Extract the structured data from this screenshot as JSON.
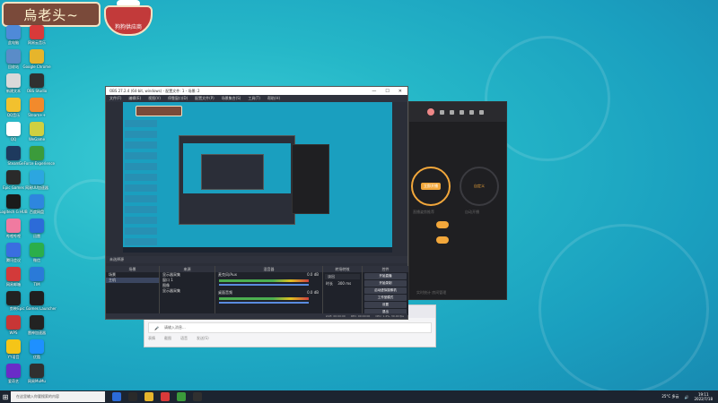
{
  "logo": {
    "title": "烏老头~",
    "bowl_label": "狗狗供应商"
  },
  "desktop_icons": [
    {
      "label": "此电脑",
      "color": "#4f8ad8"
    },
    {
      "label": "网易云音乐",
      "color": "#d83a3a"
    },
    {
      "label": "回收站",
      "color": "#5a8cc8"
    },
    {
      "label": "Google Chrome",
      "color": "#e6b52c"
    },
    {
      "label": "新建文本",
      "color": "#d9d9d9"
    },
    {
      "label": "OBS Studio",
      "color": "#303030"
    },
    {
      "label": "QQ音乐",
      "color": "#f2c12e"
    },
    {
      "label": "Steam++",
      "color": "#f28a2c"
    },
    {
      "label": "QQ",
      "color": "#ffffff"
    },
    {
      "label": "WeGame",
      "color": "#d0d040"
    },
    {
      "label": "Steam",
      "color": "#1e3a5e"
    },
    {
      "label": "GeForce Experience",
      "color": "#3b9b3b"
    },
    {
      "label": "Epic Games",
      "color": "#2a2a2a"
    },
    {
      "label": "网易UU加速器",
      "color": "#2ca6e0"
    },
    {
      "label": "Logitech G HUB",
      "color": "#1a1a1a"
    },
    {
      "label": "百度网盘",
      "color": "#2e86de"
    },
    {
      "label": "哔哩哔哩",
      "color": "#f07aa0"
    },
    {
      "label": "迅雷",
      "color": "#2c6bd8"
    },
    {
      "label": "腾讯会议",
      "color": "#3a6ee0"
    },
    {
      "label": "微信",
      "color": "#2bae4a"
    },
    {
      "label": "网易邮箱",
      "color": "#d33a3a"
    },
    {
      "label": "TIM",
      "color": "#2a7ad8"
    },
    {
      "label": "剪映",
      "color": "#222222"
    },
    {
      "label": "Epic Games Launcher",
      "color": "#1f1f1f"
    },
    {
      "label": "WPS",
      "color": "#c83636"
    },
    {
      "label": "雷神加速器",
      "color": "#222222"
    },
    {
      "label": "YY语音",
      "color": "#f5c518"
    },
    {
      "label": "优酷",
      "color": "#1e90ff"
    },
    {
      "label": "爱奇艺",
      "color": "#6a2cc8"
    },
    {
      "label": "网易MuMu",
      "color": "#303030"
    }
  ],
  "obs": {
    "title": "OBS 27.2.4 (64-bit, windows) - 配置文件: 1 - 场景: 2",
    "menu": [
      "文件(F)",
      "编辑(E)",
      "视图(V)",
      "停靠窗口(D)",
      "配置文件(P)",
      "场景集合(S)",
      "工具(T)",
      "帮助(H)"
    ],
    "window_controls": [
      "—",
      "☐",
      "✕"
    ],
    "source_bar": "未选择源",
    "scenes_header": "场景",
    "scenes": [
      "场景",
      "主机"
    ],
    "sources_header": "来源",
    "sources": [
      "显示器采集",
      "窗口 1",
      "图像",
      "显示器采集"
    ],
    "mixer_header": "混音器",
    "mixer": [
      {
        "name": "麦克风/Aux",
        "db": "0.0 dB"
      },
      {
        "name": "桌面音频",
        "db": "0.0 dB"
      }
    ],
    "transition_header": "转场特效",
    "transition": {
      "type": "淡出",
      "duration_label": "时长",
      "duration": "300 ms"
    },
    "controls_header": "控件",
    "controls": [
      "开始直播",
      "开始录制",
      "启动虚拟摄像机",
      "工作室模式",
      "设置",
      "退出"
    ],
    "status": [
      "LIVE: 00:00:00",
      "REC: 00:00:00",
      "CPU: 1.4%, 30.00 fps"
    ]
  },
  "app_window": {
    "pill_1": "立即开播",
    "pill_2": "自定义",
    "circle_1_caption": "直播姿势推荐",
    "circle_2_caption": "自动开播",
    "footer": "实时统计  房间管理",
    "accent": "#f2a73b"
  },
  "chat": {
    "tabs": [
      "今天",
      "19:32",
      "消息记录"
    ],
    "input_placeholder": "请输入消息...",
    "bottom": [
      "表情",
      "截图",
      "语音",
      "发送(S)"
    ]
  },
  "taskbar": {
    "start_icon": "windows-logo-icon",
    "search_placeholder": "在这里输入你要搜索的内容",
    "apps": [
      "#2c6bd8",
      "#2a2a2a",
      "#e6b52c",
      "#d83a3a",
      "#3b9b3b",
      "#303030"
    ],
    "temperature": "25°C  多云",
    "time": "19:11",
    "date": "2022/7/18"
  }
}
